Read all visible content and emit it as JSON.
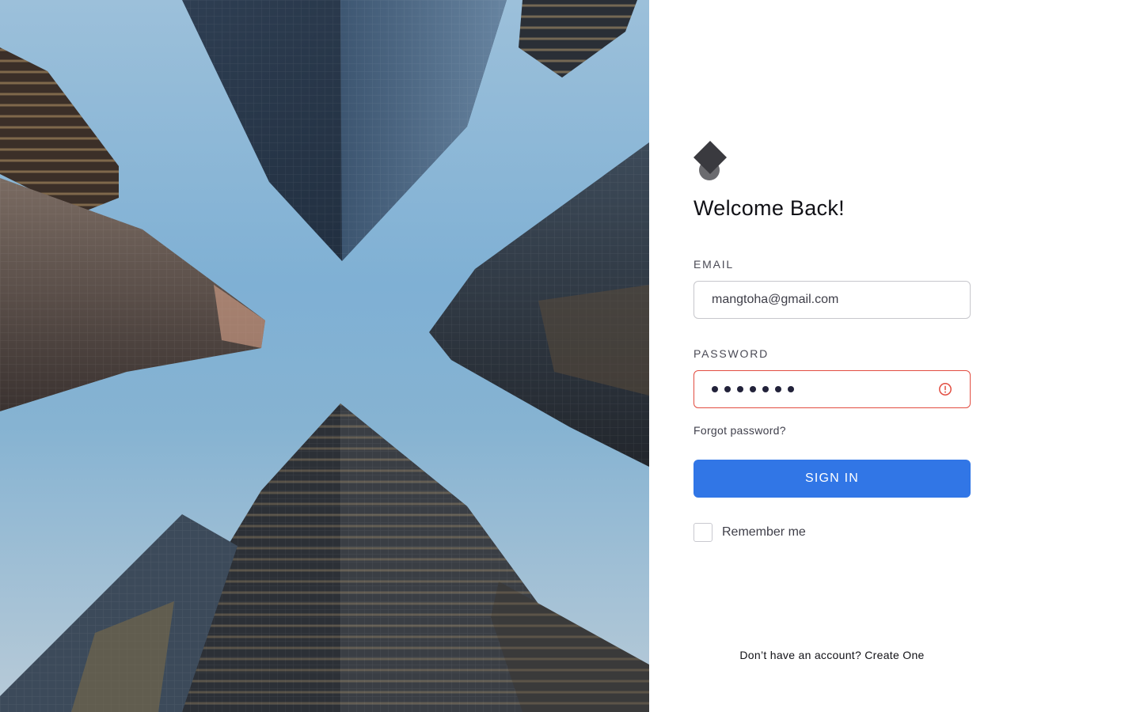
{
  "hero": {
    "image_icon": "skyscrapers-looking-up-photo"
  },
  "login": {
    "logo_icon": "diamond-circle-logo",
    "title": "Welcome Back!",
    "email_label": "EMAIL",
    "email_value": "mangtoha@gmail.com",
    "password_label": "PASSWORD",
    "password_masked_length": 7,
    "password_error_icon": "alert-circle-icon",
    "forgot_label": "Forgot password?",
    "signin_label": "SIGN IN",
    "remember_label": "Remember me",
    "remember_checked": false,
    "signup_prompt": "Don’t have an account?",
    "signup_link": "Create One"
  },
  "colors": {
    "accent": "#3176e6",
    "error": "#e24d41",
    "sky": "#86b3d2",
    "logo": "#3a3a3f"
  }
}
